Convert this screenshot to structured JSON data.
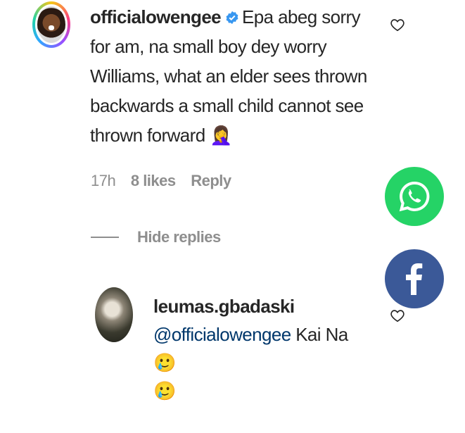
{
  "comment": {
    "username": "officialowengee",
    "text": "Epa abeg sorry for am, na small boy dey worry Williams, what an elder sees thrown backwards a small child cannot see thrown forward",
    "emoji": "🤦‍♀️",
    "time": "17h",
    "likes": "8 likes",
    "reply_label": "Reply"
  },
  "hide_replies_label": "Hide replies",
  "reply": {
    "username": "leumas.gbadaski",
    "mention": "@officialowengee",
    "text": "Kai Na",
    "emoji1": "🥲",
    "emoji2": "🥲"
  },
  "colors": {
    "whatsapp": "#25d366",
    "facebook": "#3b5998",
    "verified": "#3897f0",
    "mention": "#00376b"
  },
  "icons": {
    "whatsapp": "whatsapp-icon",
    "facebook": "facebook-icon",
    "like": "heart-outline-icon",
    "verified": "verified-badge-icon"
  }
}
